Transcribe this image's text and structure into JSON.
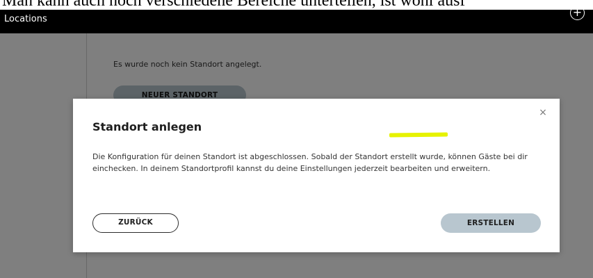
{
  "doc_strip": {
    "text": "Man kann auch noch verschiedene Bereiche unterteilen, ist wohl ausf"
  },
  "app": {
    "title": "Locations",
    "add_icon": "plus-circle-icon",
    "add_glyph": "+"
  },
  "page": {
    "empty_message": "Es wurde noch kein Standort angelegt.",
    "new_location_label": "NEUER STANDORT"
  },
  "modal": {
    "title": "Standort anlegen",
    "body": "Die Konfiguration für deinen Standort ist abgeschlossen. Sobald der Standort erstellt wurde, können Gäste bei dir einchecken. In deinem Standortprofil kannst du deine Einstellungen jederzeit bearbeiten und erweitern.",
    "close_icon": "close-icon",
    "close_glyph": "×",
    "back_label": "ZURÜCK",
    "create_label": "ERSTELLEN"
  },
  "colors": {
    "topbar": "#000000",
    "button_fill": "#b8c6cf",
    "highlight": "#e6f200"
  }
}
